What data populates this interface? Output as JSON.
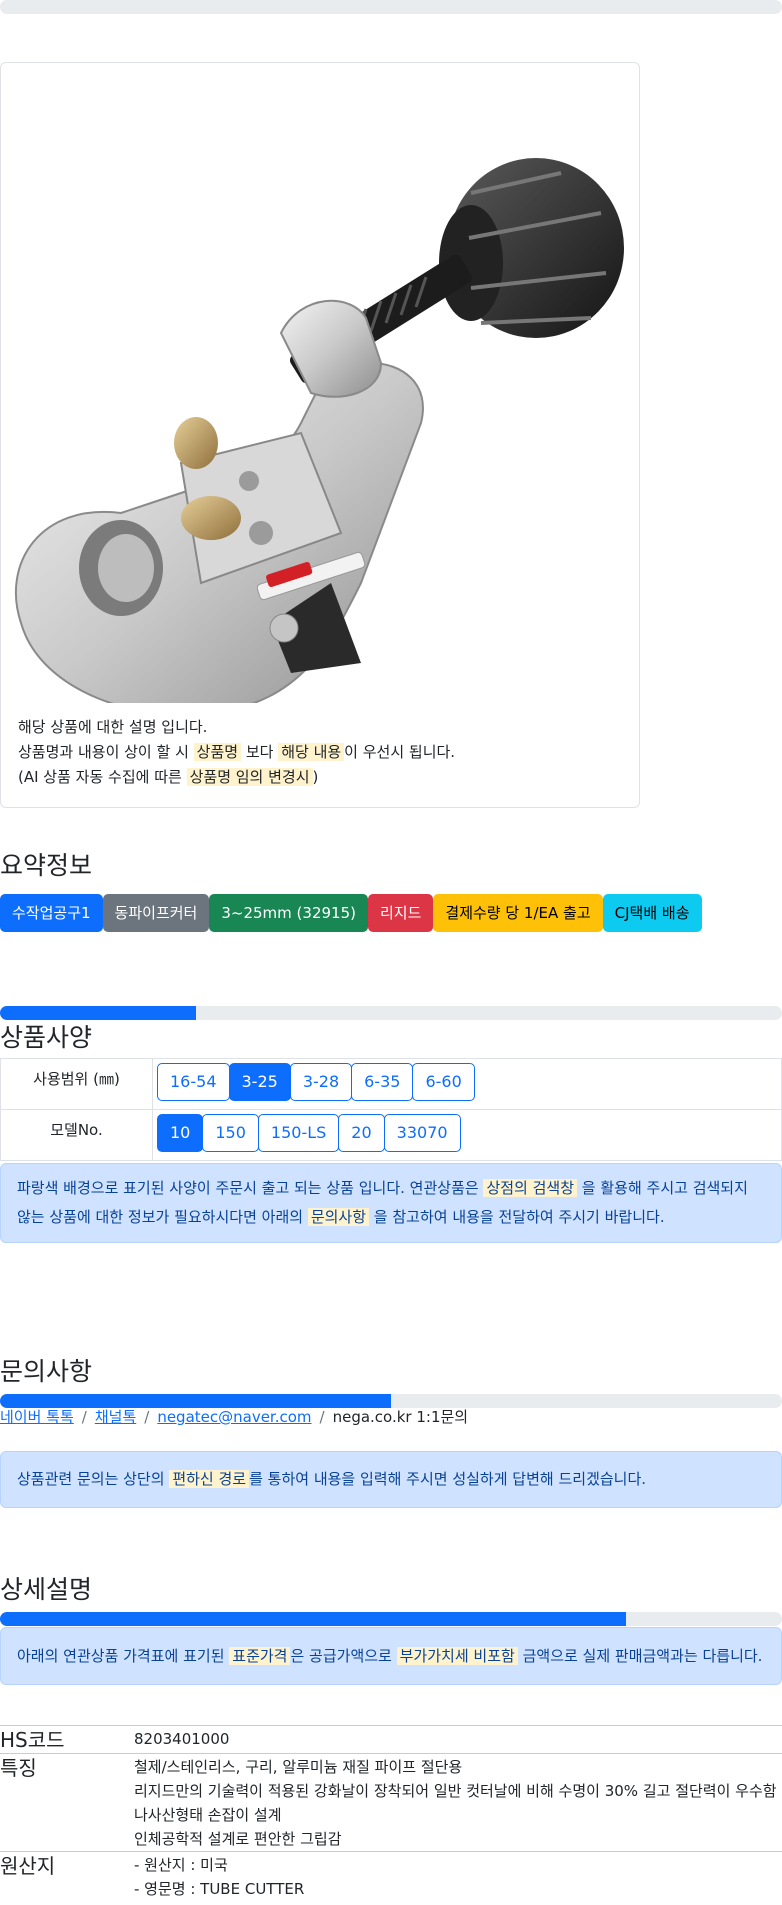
{
  "image_card": {
    "desc_lines": [
      {
        "parts": [
          {
            "t": "해당 상품에 대한 설명 입니다.",
            "hl": false
          }
        ]
      },
      {
        "parts": [
          {
            "t": "상품명과 내용이 상이 할 시 ",
            "hl": false
          },
          {
            "t": "상품명",
            "hl": true
          },
          {
            "t": " 보다 ",
            "hl": false
          },
          {
            "t": "해당 내용",
            "hl": true
          },
          {
            "t": "이 우선시 됩니다.",
            "hl": false
          }
        ]
      },
      {
        "parts": [
          {
            "t": "(AI 상품 자동 수집에 따른 ",
            "hl": false
          },
          {
            "t": "상품명 임의 변경시",
            "hl": true
          },
          {
            "t": ")",
            "hl": false
          }
        ]
      }
    ]
  },
  "summary": {
    "title": "요약정보",
    "tags": [
      {
        "label": "수작업공구1",
        "color": "#0d6efd",
        "text_color": "#ffffff"
      },
      {
        "label": "동파이프커터",
        "color": "#6c757d",
        "text_color": "#ffffff"
      },
      {
        "label": "3~25mm (32915)",
        "color": "#198754",
        "text_color": "#ffffff"
      },
      {
        "label": "리지드",
        "color": "#dc3545",
        "text_color": "#ffffff"
      },
      {
        "label": "결제수량 당 1/EA 출고",
        "color": "#ffc107",
        "text_color": "#000000"
      },
      {
        "label": "CJ택배 배송",
        "color": "#0dcaf0",
        "text_color": "#000000"
      }
    ]
  },
  "spec": {
    "title": "상품사양",
    "progress_percent": 25,
    "rows": [
      {
        "label": "사용범위 (㎜)",
        "options": [
          "16-54",
          "3-25",
          "3-28",
          "6-35",
          "6-60"
        ],
        "selected": "3-25"
      },
      {
        "label": "모델No.",
        "options": [
          "10",
          "150",
          "150-LS",
          "20",
          "33070"
        ],
        "selected": "10"
      }
    ],
    "notice_parts": [
      {
        "t": "파랑색 배경으로 표기된 사양이 주문시 출고 되는 상품 입니다. 연관상품은 ",
        "hl": false
      },
      {
        "t": "상점의 검색창",
        "hl": true
      },
      {
        "t": " 을 활용해 주시고 검색되지 않는 상품에 대한 정보가 필요하시다면 아래의 ",
        "hl": false
      },
      {
        "t": "문의사항",
        "hl": true
      },
      {
        "t": " 을 참고하여 내용을 전달하여 주시기 바랍니다.",
        "hl": false
      }
    ]
  },
  "inquiry": {
    "title": "문의사항",
    "progress_percent": 50,
    "links": [
      "네이버 톡톡",
      "채널톡",
      "negatec@naver.com"
    ],
    "plain": "nega.co.kr 1:1문의",
    "notice_parts": [
      {
        "t": "상품관련 문의는 상단의 ",
        "hl": false
      },
      {
        "t": "편하신 경로",
        "hl": true
      },
      {
        "t": "를 통하여 내용을 입력해 주시면 성실하게 답변해 드리겠습니다.",
        "hl": false
      }
    ]
  },
  "detail": {
    "title": "상세설명",
    "progress_percent": 80,
    "notice_parts": [
      {
        "t": "아래의 연관상품 가격표에 표기된 ",
        "hl": false
      },
      {
        "t": "표준가격",
        "hl": true
      },
      {
        "t": "은 공급가액으로 ",
        "hl": false
      },
      {
        "t": "부가가치세 비포함",
        "hl": true
      },
      {
        "t": " 금액으로 실제 판매금액과는 다릅니다.",
        "hl": false
      }
    ],
    "rows": [
      {
        "key": "HS코드",
        "lines": [
          "8203401000"
        ]
      },
      {
        "key": "특징",
        "lines": [
          "철제/스테인리스, 구리, 알루미늄 재질 파이프 절단용",
          "리지드만의 기술력이 적용된 강화날이 장착되어 일반 컷터날에 비해 수명이 30% 길고 절단력이 우수함",
          "나사산형태 손잡이 설계",
          "인체공학적 설계로 편안한 그립감"
        ]
      },
      {
        "key": "원산지",
        "lines": [
          "- 원산지 : 미국",
          "- 영문명 : TUBE CUTTER"
        ]
      }
    ]
  }
}
